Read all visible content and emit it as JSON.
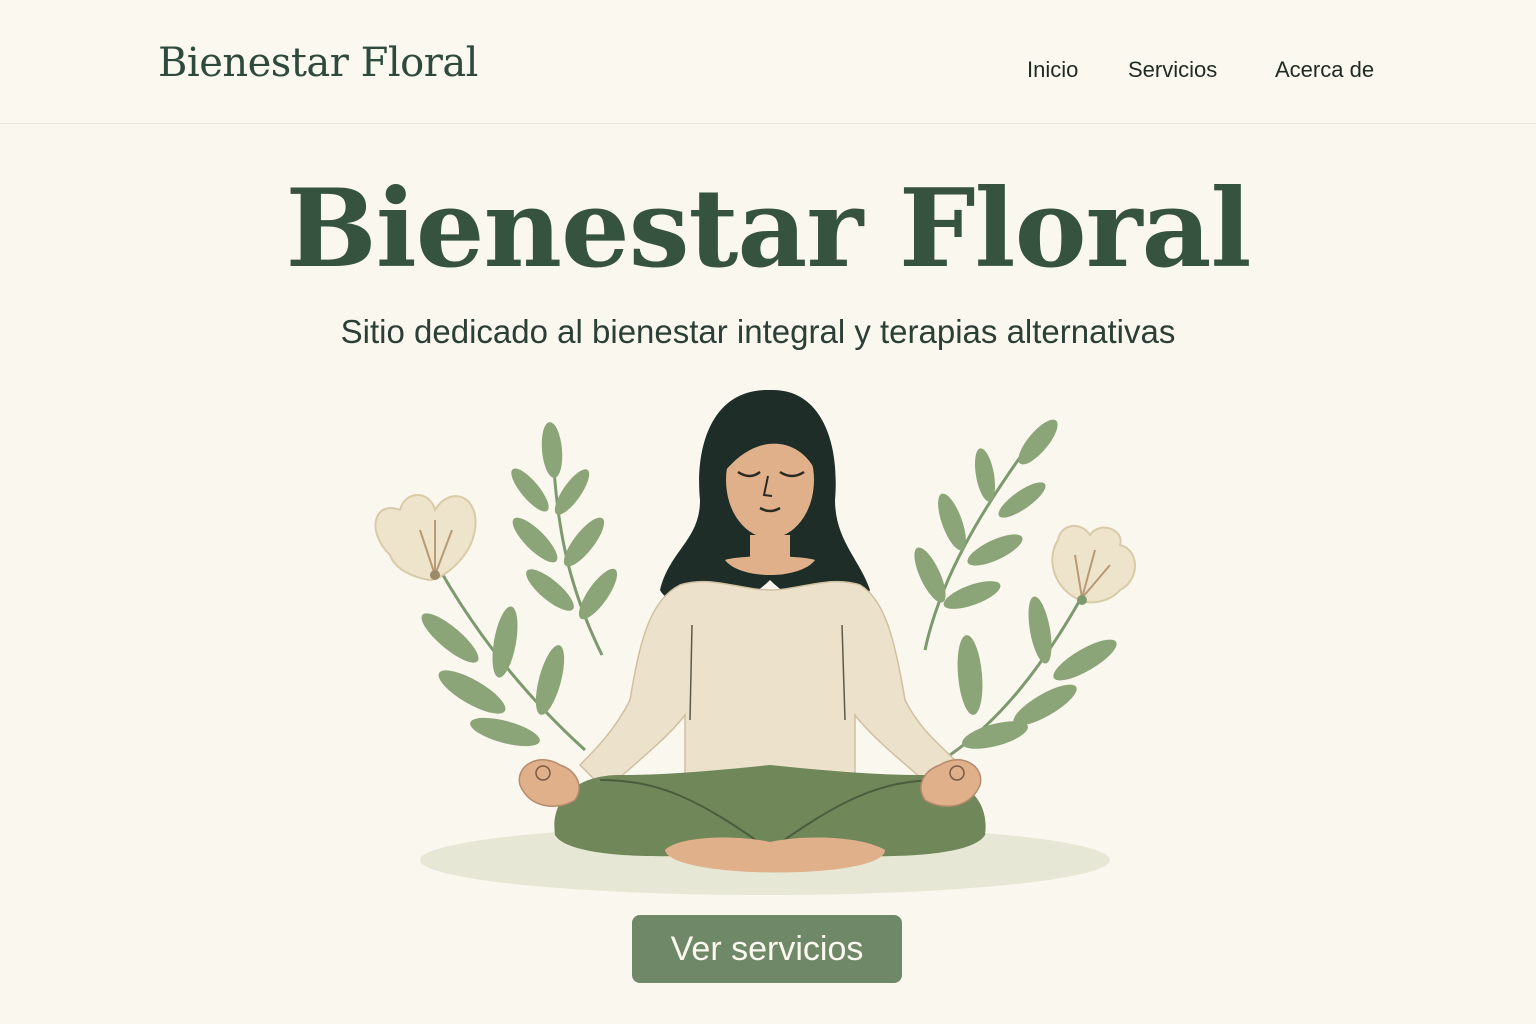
{
  "header": {
    "logo": "Bienestar Floral",
    "nav": [
      "Inicio",
      "Servicios",
      "Acerca de"
    ]
  },
  "hero": {
    "title": "Bienestar Floral",
    "subtitle": "Sitio dedicado al bienestar integral y terapias alternativas",
    "cta_label": "Ver servicios",
    "illustration": "meditating-woman-with-flowers-illustration"
  },
  "colors": {
    "background": "#faf7ee",
    "primary_text": "#36533f",
    "button": "#6f8868",
    "leaf": "#8ba478",
    "pants": "#6f8759",
    "shirt": "#ece2cc",
    "skin": "#e0b08a",
    "hair": "#1f2d28",
    "flower": "#eee4cb"
  }
}
